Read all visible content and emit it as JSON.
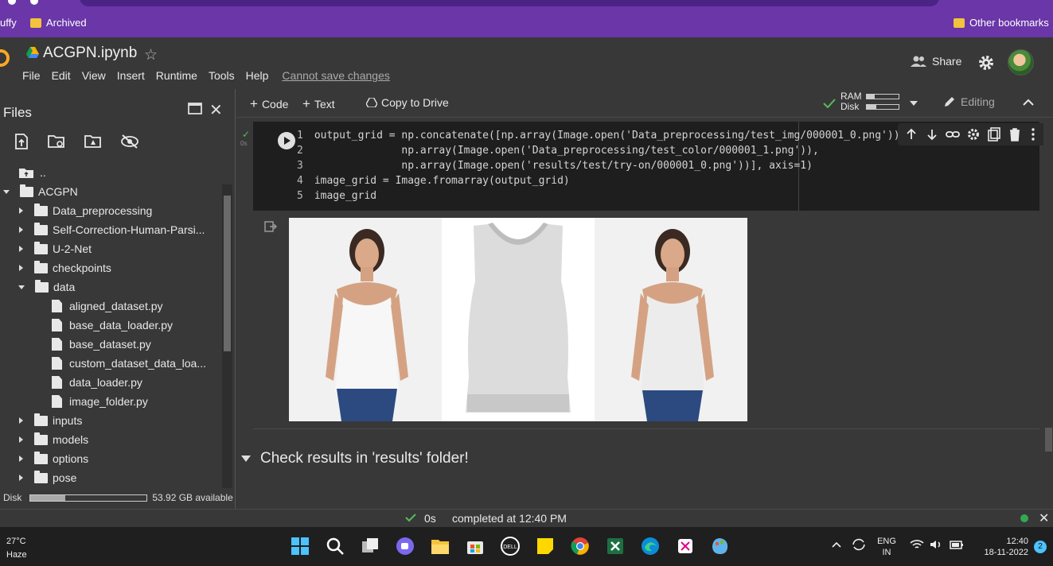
{
  "bookmarks": {
    "left_fragment": "uffy",
    "archived": "Archived",
    "other": "Other bookmarks"
  },
  "colab": {
    "title": "ACGPN.ipynb",
    "menu": [
      "File",
      "Edit",
      "View",
      "Insert",
      "Runtime",
      "Tools",
      "Help"
    ],
    "cannot_save": "Cannot save changes",
    "share": "Share"
  },
  "sidebar": {
    "title": "Files",
    "tree": [
      {
        "label": "..",
        "type": "up"
      },
      {
        "label": "ACGPN",
        "type": "folder",
        "expanded": true
      },
      {
        "label": "Data_preprocessing",
        "type": "folder"
      },
      {
        "label": "Self-Correction-Human-Parsi...",
        "type": "folder"
      },
      {
        "label": "U-2-Net",
        "type": "folder"
      },
      {
        "label": "checkpoints",
        "type": "folder"
      },
      {
        "label": "data",
        "type": "folder",
        "expanded": true
      },
      {
        "label": "aligned_dataset.py",
        "type": "file"
      },
      {
        "label": "base_data_loader.py",
        "type": "file"
      },
      {
        "label": "base_dataset.py",
        "type": "file"
      },
      {
        "label": "custom_dataset_data_loa...",
        "type": "file"
      },
      {
        "label": "data_loader.py",
        "type": "file"
      },
      {
        "label": "image_folder.py",
        "type": "file"
      },
      {
        "label": "inputs",
        "type": "folder"
      },
      {
        "label": "models",
        "type": "folder"
      },
      {
        "label": "options",
        "type": "folder"
      },
      {
        "label": "pose",
        "type": "folder"
      }
    ],
    "disk_label": "Disk",
    "disk_used_fraction": 0.3,
    "disk_available": "53.92 GB available"
  },
  "toolbar": {
    "code": "Code",
    "text": "Text",
    "copy_to_drive": "Copy to Drive",
    "ram": "RAM",
    "disk": "Disk",
    "ram_fraction": 0.25,
    "disk_fraction": 0.3,
    "editing": "Editing"
  },
  "cell": {
    "exec_time": "0s",
    "lines": [
      "output_grid = np.concatenate([np.array(Image.open('Data_preprocessing/test_img/000001_0.png')),",
      "              np.array(Image.open('Data_preprocessing/test_color/000001_1.png')),",
      "              np.array(Image.open('results/test/try-on/000001_0.png'))], axis=1)",
      "image_grid = Image.fromarray(output_grid)",
      "image_grid"
    ]
  },
  "section_heading": "Check results in 'results' folder!",
  "status": {
    "time": "0s",
    "message": "completed at 12:40 PM"
  },
  "taskbar": {
    "temp": "27°C",
    "weather": "Haze",
    "lang1": "ENG",
    "lang2": "IN",
    "clock": "12:40",
    "date": "18-11-2022",
    "notif": "2"
  }
}
